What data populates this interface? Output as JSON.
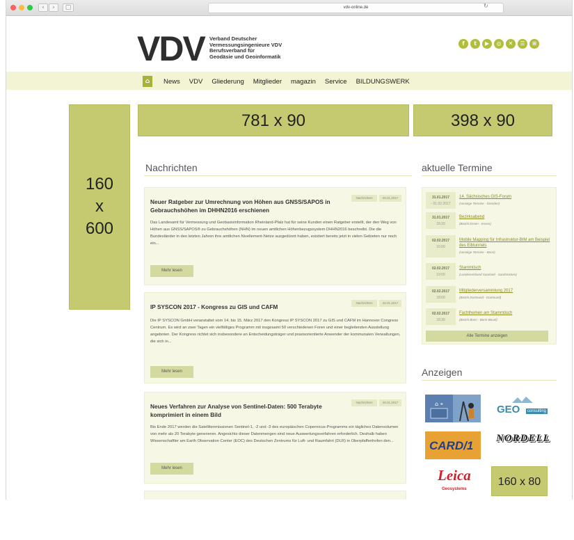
{
  "browser": {
    "url": "vdv-online.de",
    "reload_icon": "reload-icon",
    "nav": [
      "‹",
      "›",
      "▢"
    ]
  },
  "colors": {
    "accent": "#b2bd3c",
    "ad_placeholder": "#c5c970",
    "nav_background": "#f2f4d3",
    "card_background": "#f6f7e4"
  },
  "logo": {
    "mark": "VDV",
    "line1": "Verband Deutscher",
    "line2": "Vermessungsingenieure VDV",
    "line3": "Berufsverband für",
    "line4": "Geodäsie und Geoinformatik"
  },
  "social": [
    "f",
    "t",
    "▶",
    "◎",
    "✕",
    "☰",
    "≡"
  ],
  "menu": {
    "home": "⌂",
    "items": [
      "News",
      "VDV",
      "Gliederung",
      "Mitglieder",
      "magazin",
      "Service",
      "BILDUNGSWERK"
    ]
  },
  "ads": {
    "skyscraper_line1": "160",
    "skyscraper_line2": "x",
    "skyscraper_line3": "600",
    "leaderboard": "781 x 90",
    "banner": "398 x 90",
    "small": "160 x 80"
  },
  "news": {
    "title": "Nachrichten",
    "read_more": "Mehr lesen",
    "articles": [
      {
        "title": "Neuer Ratgeber zur Umrechnung von Höhen aus GNSS/SAPOS in Gebrauchshöhen im DHHN2016 erschienen",
        "category": "Nachrichten",
        "date": "26.01.2017",
        "text": "Das Landesamt für Vermessung und Geobasisinformation Rheinland-Pfalz hat für seine Kunden einen Ratgeber erstellt, der den Weg von Höhen aus GNSS/SAPOS® zu Gebrauchshöhen (NHN) im neuen amtlichen Höhenbezugssystem DHHN2016 beschreibt. Die die Bundesländer in den letzten Jahren ihre amtlichen Nivellement-Netze ausgedünnt haben, existiert bereits jetzt in vielen Gebieten nur noch ein..."
      },
      {
        "title": "IP SYSCON 2017 - Kongress zu GIS und CAFM",
        "category": "Nachrichten",
        "date": "26.01.2017",
        "text": "Die IP SYSCON GmbH veranstaltet vom 14. bis 15. März 2017 den Kongress IP SYSCON 2017 zu GIS und CAFM im Hannover Congress Centrum. Es wird an zwei Tagen ein vielfältiges Programm mit insgesamt 50 verschiedenen Foren und einer begleitenden Ausstellung angeboten. Der Kongress richtet sich insbesondere an Entscheidungsträger und praxisorientierte Anwender der kommunalen Verwaltungen, die sich in..."
      },
      {
        "title": "Neues Verfahren zur Analyse von Sentinel-Daten: 500 Terabyte komprimiert in einem Bild",
        "category": "Nachrichten",
        "date": "26.01.2017",
        "text": "Bis Ende 2017 werden die Satellitenmissionen Sentinel-1, -2 und -3 des europäischen Copernicus-Programms ein tägliches Datenvolumen von mehr als 20 Terabyte generieren. Angesichts dieser Datenmengen sind neue Auswertungsverfahren erforderlich. Deshalb haben Wissenschaftler am Earth Observation Center (EOC) des Deutschen Zentrums für Luft- und Raumfahrt (DLR) in Oberpfaffenhofen den..."
      }
    ]
  },
  "termine": {
    "title": "aktuelle Termine",
    "button": "Alle Termine anzeigen",
    "events": [
      {
        "date": "31.01.2017",
        "time": "- 01.02.2017",
        "title": "14. Sächsisches GIS-Forum",
        "sub": "(sonstige Termine - Dresden)"
      },
      {
        "date": "31.01.2017",
        "time": "18:30",
        "title": "Bezirksabend",
        "sub": "(Bezirk Essen - Essen)"
      },
      {
        "date": "02.02.2017",
        "time": "16:00",
        "title": "Mobile Mapping für Infrastruktur-BIM am Beispiel des Elbtunnels",
        "sub": "(sonstige Termine - Bonn)"
      },
      {
        "date": "02.02.2017",
        "time": "19:00",
        "title": "Stammtisch",
        "sub": "(Landesverband Saarland - Saarbrücken)"
      },
      {
        "date": "02.02.2017",
        "time": "18:00",
        "title": "Mitgliederversammlung 2017",
        "sub": "(Bezirk Dortmund - Dortmund)"
      },
      {
        "date": "02.02.2017",
        "time": "18:30",
        "title": "Fachthemen am Stammtisch",
        "sub": "(Bezirk Bonn - Bonn-Beuel)"
      }
    ]
  },
  "anzeigen": {
    "title": "Anzeigen",
    "geo": "GEO",
    "geo_sub": "consulting",
    "card": "CARD/1",
    "nordell": "NORDELL",
    "leica": "Leica",
    "leica_sub": "Geosystems"
  }
}
